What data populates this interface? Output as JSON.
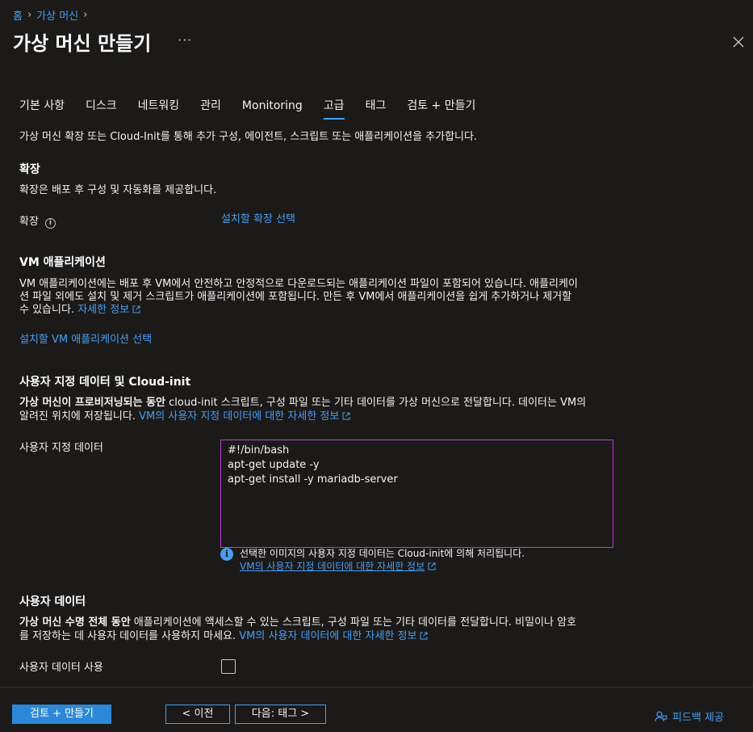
{
  "breadcrumb": {
    "items": [
      "홈",
      "가상 머신"
    ]
  },
  "header": {
    "title": "가상 머신 만들기",
    "more": "···"
  },
  "tabs": [
    {
      "label": "기본 사항"
    },
    {
      "label": "디스크"
    },
    {
      "label": "네트워킹"
    },
    {
      "label": "관리"
    },
    {
      "label": "Monitoring"
    },
    {
      "label": "고급",
      "active": true
    },
    {
      "label": "태그"
    },
    {
      "label": "검토 + 만들기"
    }
  ],
  "intro": "가상 머신 확장 또는 Cloud-Init를 통해 추가 구성, 에이전트, 스크립트 또는 애플리케이션을 추가합니다.",
  "extensions": {
    "heading": "확장",
    "description": "확장은 배포 후 구성 및 자동화를 제공합니다.",
    "label": "확장",
    "link": "설치할 확장 선택"
  },
  "vm_apps": {
    "heading": "VM 애플리케이션",
    "line1": "VM 애플리케이션에는 배포 후 VM에서 안전하고 안정적으로 다운로드되는 애플리케이션 파일이 포함되어 있습니다. 애플리케이",
    "line2": "션 파일 외에도 설치 및 제거 스크립트가 애플리케이션에 포함됩니다. 만든 후 VM에서 애플리케이션을 쉽게 추가하거나 제거할",
    "line3": "수 있습니다.",
    "learn_more": "자세한 정보",
    "select_link": "설치할 VM 애플리케이션 선택"
  },
  "custom_data": {
    "heading": "사용자 지정 데이터 및 Cloud-init",
    "line1_bold": "가상 머신이 프로비저닝되는 동안",
    "line1_rest": " cloud-init 스크립트, 구성 파일 또는 기타 데이터를 가상 머신으로 전달합니다. 데이터는 VM의",
    "line2": "알려진 위치에 저장됩니다.",
    "learn_more": "VM의 사용자 지정 데이터에 대한 자세한 정보",
    "field_label": "사용자 지정 데이터",
    "value": "#!/bin/bash\napt-get update -y\napt-get install -y mariadb-server",
    "note": "선택한 이미지의 사용자 지정 데이터는 Cloud-init에 의해 처리됩니다.",
    "note_link": "VM의 사용자 지정 데이터에 대한 자세한 정보"
  },
  "user_data": {
    "heading": "사용자 데이터",
    "line1_bold": "가상 머신 수명 전체 동안",
    "line1_rest": " 애플리케이션에 액세스할 수 있는 스크립트, 구성 파일 또는 기타 데이터를 전달합니다. 비밀이나 암호",
    "line2": "를 저장하는 데 사용자 데이터를 사용하지 마세요.",
    "learn_more": "VM의 사용자 데이터에 대한 자세한 정보",
    "field_label": "사용자 데이터 사용",
    "checked": false
  },
  "footer": {
    "review_create": "검토 + 만들기",
    "previous": "< 이전",
    "next": "다음: 태그 >",
    "feedback": "피드백 제공"
  },
  "colors": {
    "background": "#1b1a19",
    "accent": "#479ef5",
    "primary_button": "#2b88d8",
    "focus_border": "#c239d6"
  }
}
